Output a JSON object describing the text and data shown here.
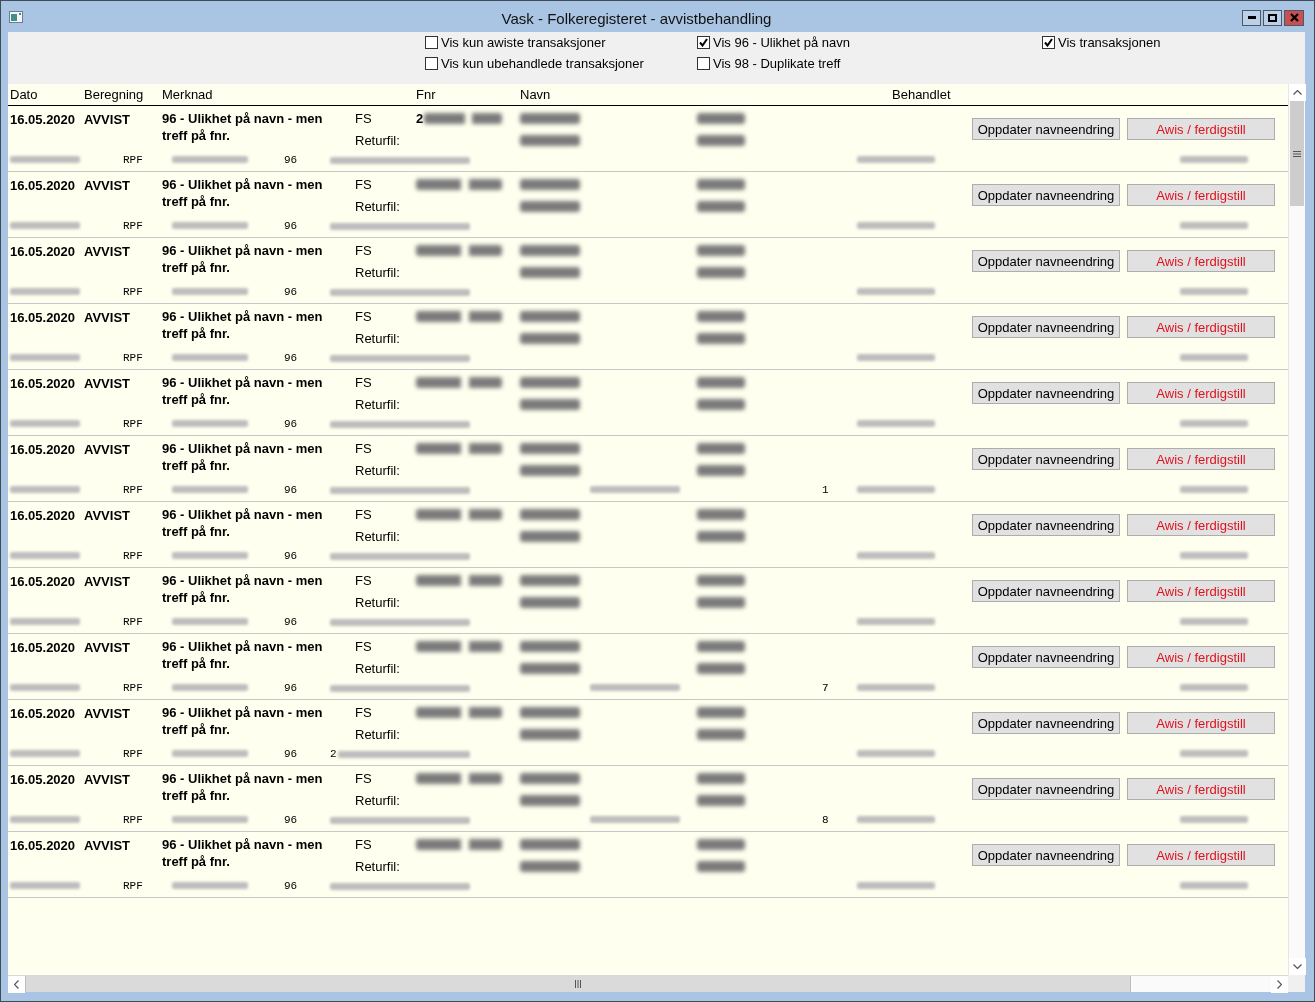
{
  "window": {
    "title": "Vask - Folkeregisteret - avvistbehandling"
  },
  "filters": [
    {
      "label": "Vis kun awiste transaksjoner",
      "checked": false
    },
    {
      "label": "Vis 96 - Ulikhet på navn",
      "checked": true
    },
    {
      "label": "Vis transaksjonen",
      "checked": true
    },
    {
      "label": "Vis kun ubehandlede transaksjoner",
      "checked": false
    },
    {
      "label": "Vis 98 - Duplikate treff",
      "checked": false
    }
  ],
  "table": {
    "columns": [
      "Dato",
      "Beregning",
      "Merknad",
      "Fnr",
      "Navn",
      "Behandlet"
    ],
    "rows": [
      {
        "date": "16.05.2020",
        "status": "AVVIST",
        "remark": "96 - Ulikhet på navn - men treff på fnr.",
        "source": "FS",
        "returfil": "Returfil:",
        "fnr_prefix": "2",
        "type": "RPF",
        "code": "96",
        "buttons": [
          {
            "label": "Oppdater navneendring",
            "kind": "default"
          },
          {
            "label": "Awis / ferdigstill",
            "kind": "warning"
          }
        ]
      },
      {
        "date": "16.05.2020",
        "status": "AVVIST",
        "remark": "96 - Ulikhet på navn - men treff på fnr.",
        "source": "FS",
        "returfil": "Returfil:",
        "type": "RPF",
        "code": "96",
        "buttons": [
          {
            "label": "Oppdater navneendring",
            "kind": "default"
          },
          {
            "label": "Awis / ferdigstill",
            "kind": "warning"
          }
        ]
      },
      {
        "date": "16.05.2020",
        "status": "AVVIST",
        "remark": "96 - Ulikhet på navn - men treff på fnr.",
        "source": "FS",
        "returfil": "Returfil:",
        "type": "RPF",
        "code": "96",
        "buttons": [
          {
            "label": "Oppdater navneendring",
            "kind": "default"
          },
          {
            "label": "Awis / ferdigstill",
            "kind": "warning"
          }
        ]
      },
      {
        "date": "16.05.2020",
        "status": "AVVIST",
        "remark": "96 - Ulikhet på navn - men treff på fnr.",
        "source": "FS",
        "returfil": "Returfil:",
        "type": "RPF",
        "code": "96",
        "buttons": [
          {
            "label": "Oppdater navneendring",
            "kind": "default"
          },
          {
            "label": "Awis / ferdigstill",
            "kind": "warning"
          }
        ]
      },
      {
        "date": "16.05.2020",
        "status": "AVVIST",
        "remark": "96 - Ulikhet på navn - men treff på fnr.",
        "source": "FS",
        "returfil": "Returfil:",
        "type": "RPF",
        "code": "96",
        "buttons": [
          {
            "label": "Oppdater navneendring",
            "kind": "default"
          },
          {
            "label": "Awis / ferdigstill",
            "kind": "warning"
          }
        ]
      },
      {
        "date": "16.05.2020",
        "status": "AVVIST",
        "remark": "96 - Ulikhet på navn - men treff på fnr.",
        "source": "FS",
        "returfil": "Returfil:",
        "type": "RPF",
        "code": "96",
        "house_number": "1",
        "buttons": [
          {
            "label": "Oppdater navneendring",
            "kind": "default"
          },
          {
            "label": "Awis / ferdigstill",
            "kind": "warning"
          }
        ]
      },
      {
        "date": "16.05.2020",
        "status": "AVVIST",
        "remark": "96 - Ulikhet på navn - men treff på fnr.",
        "source": "FS",
        "returfil": "Returfil:",
        "type": "RPF",
        "code": "96",
        "buttons": [
          {
            "label": "Oppdater navneendring",
            "kind": "default"
          },
          {
            "label": "Awis / ferdigstill",
            "kind": "warning"
          }
        ]
      },
      {
        "date": "16.05.2020",
        "status": "AVVIST",
        "remark": "96 - Ulikhet på navn - men treff på fnr.",
        "source": "FS",
        "returfil": "Returfil:",
        "type": "RPF",
        "code": "96",
        "buttons": [
          {
            "label": "Oppdater navneendring",
            "kind": "default"
          },
          {
            "label": "Awis / ferdigstill",
            "kind": "warning"
          }
        ]
      },
      {
        "date": "16.05.2020",
        "status": "AVVIST",
        "remark": "96 - Ulikhet på navn - men treff på fnr.",
        "source": "FS",
        "returfil": "Returfil:",
        "type": "RPF",
        "code": "96",
        "house_number": "7",
        "buttons": [
          {
            "label": "Oppdater navneendring",
            "kind": "default"
          },
          {
            "label": "Awis / ferdigstill",
            "kind": "warning"
          }
        ]
      },
      {
        "date": "16.05.2020",
        "status": "AVVIST",
        "remark": "96 - Ulikhet på navn - men treff på fnr.",
        "source": "FS",
        "returfil": "Returfil:",
        "type": "RPF",
        "code": "96",
        "record_prefix": "2",
        "buttons": [
          {
            "label": "Oppdater navneendring",
            "kind": "default"
          },
          {
            "label": "Awis / ferdigstill",
            "kind": "warning"
          }
        ]
      },
      {
        "date": "16.05.2020",
        "status": "AVVIST",
        "remark": "96 - Ulikhet på navn - men treff på fnr.",
        "source": "FS",
        "returfil": "Returfil:",
        "type": "RPF",
        "code": "96",
        "house_number": "8",
        "buttons": [
          {
            "label": "Oppdater navneendring",
            "kind": "default"
          },
          {
            "label": "Awis / ferdigstill",
            "kind": "warning"
          }
        ]
      },
      {
        "date": "16.05.2020",
        "status": "AVVIST",
        "remark": "96 - Ulikhet på navn - men treff på fnr.",
        "source": "FS",
        "returfil": "Returfil:",
        "type": "RPF",
        "code": "96",
        "buttons": [
          {
            "label": "Oppdater navneendring",
            "kind": "default"
          },
          {
            "label": "Awis / ferdigstill",
            "kind": "warning"
          }
        ]
      }
    ]
  }
}
